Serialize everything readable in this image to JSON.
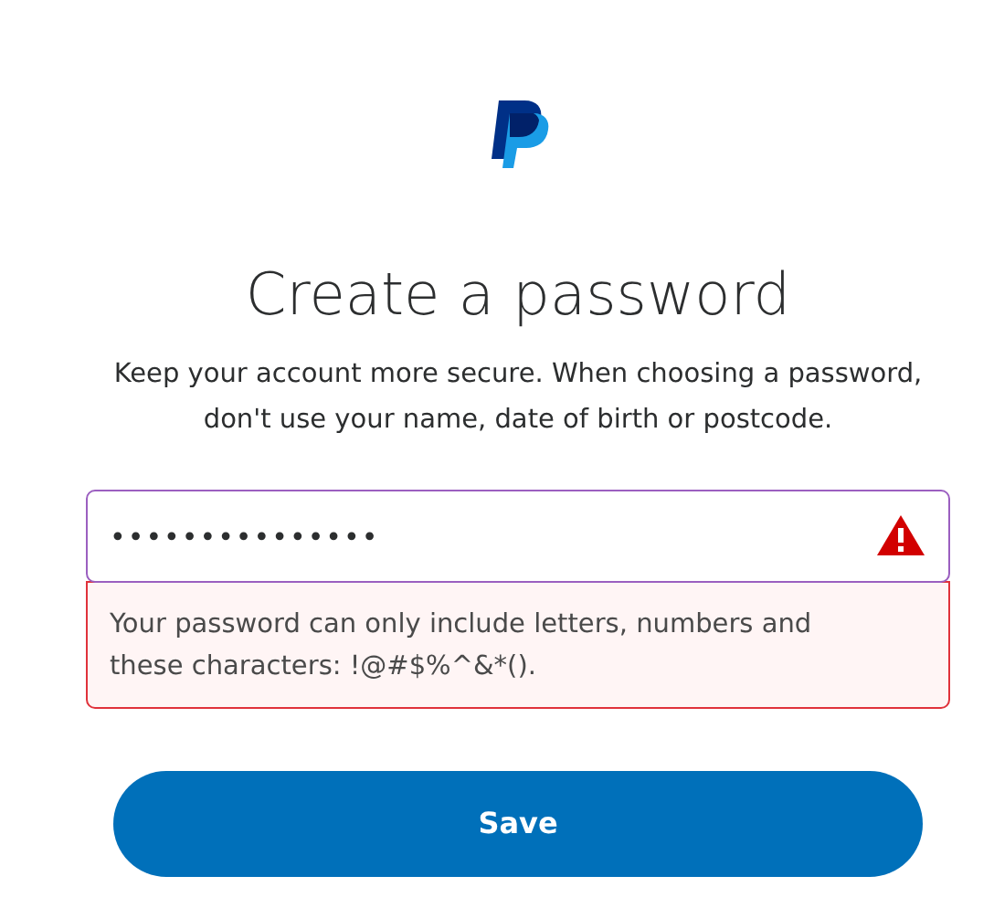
{
  "heading": "Create a password",
  "description": "Keep your account more secure. When choosing a password, don't use your name, date of birth or postcode.",
  "password_field": {
    "value": "•••••••••••••••",
    "invalid": true
  },
  "error": {
    "message": "Your password can only include letters, numbers and these characters: !@#$%^&*()."
  },
  "buttons": [
    {
      "label": "Save"
    }
  ]
}
